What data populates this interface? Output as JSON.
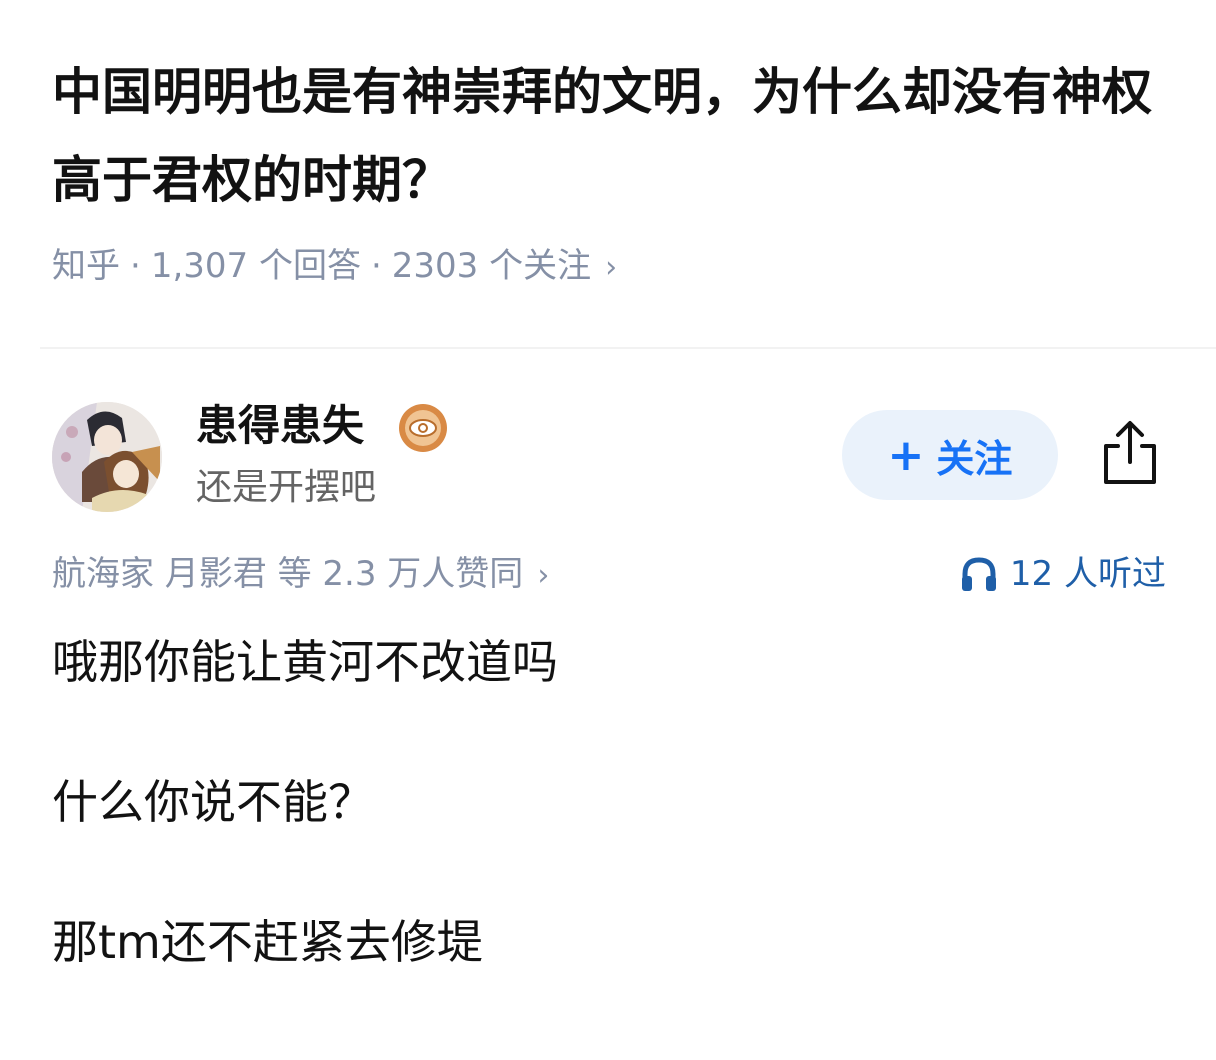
{
  "question": {
    "title": "中国明明也是有神崇拜的文明，为什么却没有神权高于君权的时期？",
    "source": "知乎",
    "answers_count": "1,307 个回答",
    "followers_count": "2303 个关注",
    "chevron": "›"
  },
  "author": {
    "name": "患得患失",
    "bio": "还是开摆吧",
    "avatar_icon": "avatar-anime-illustration",
    "badge_icon": "eye-badge-icon"
  },
  "follow_button": {
    "plus": "+",
    "label": "关注",
    "text_color": "#1772f6",
    "bg_color": "#eaf2fb"
  },
  "share": {
    "icon": "share-icon"
  },
  "upvotes": {
    "text": "航海家 月影君 等 2.3 万人赞同",
    "chevron": "›"
  },
  "listens": {
    "icon": "headphones-icon",
    "text": "12 人听过",
    "color": "#1f5fa8"
  },
  "answer": {
    "paragraphs": [
      "哦那你能让黄河不改道吗",
      "什么你说不能？",
      "那tm还不赶紧去修堤"
    ]
  }
}
